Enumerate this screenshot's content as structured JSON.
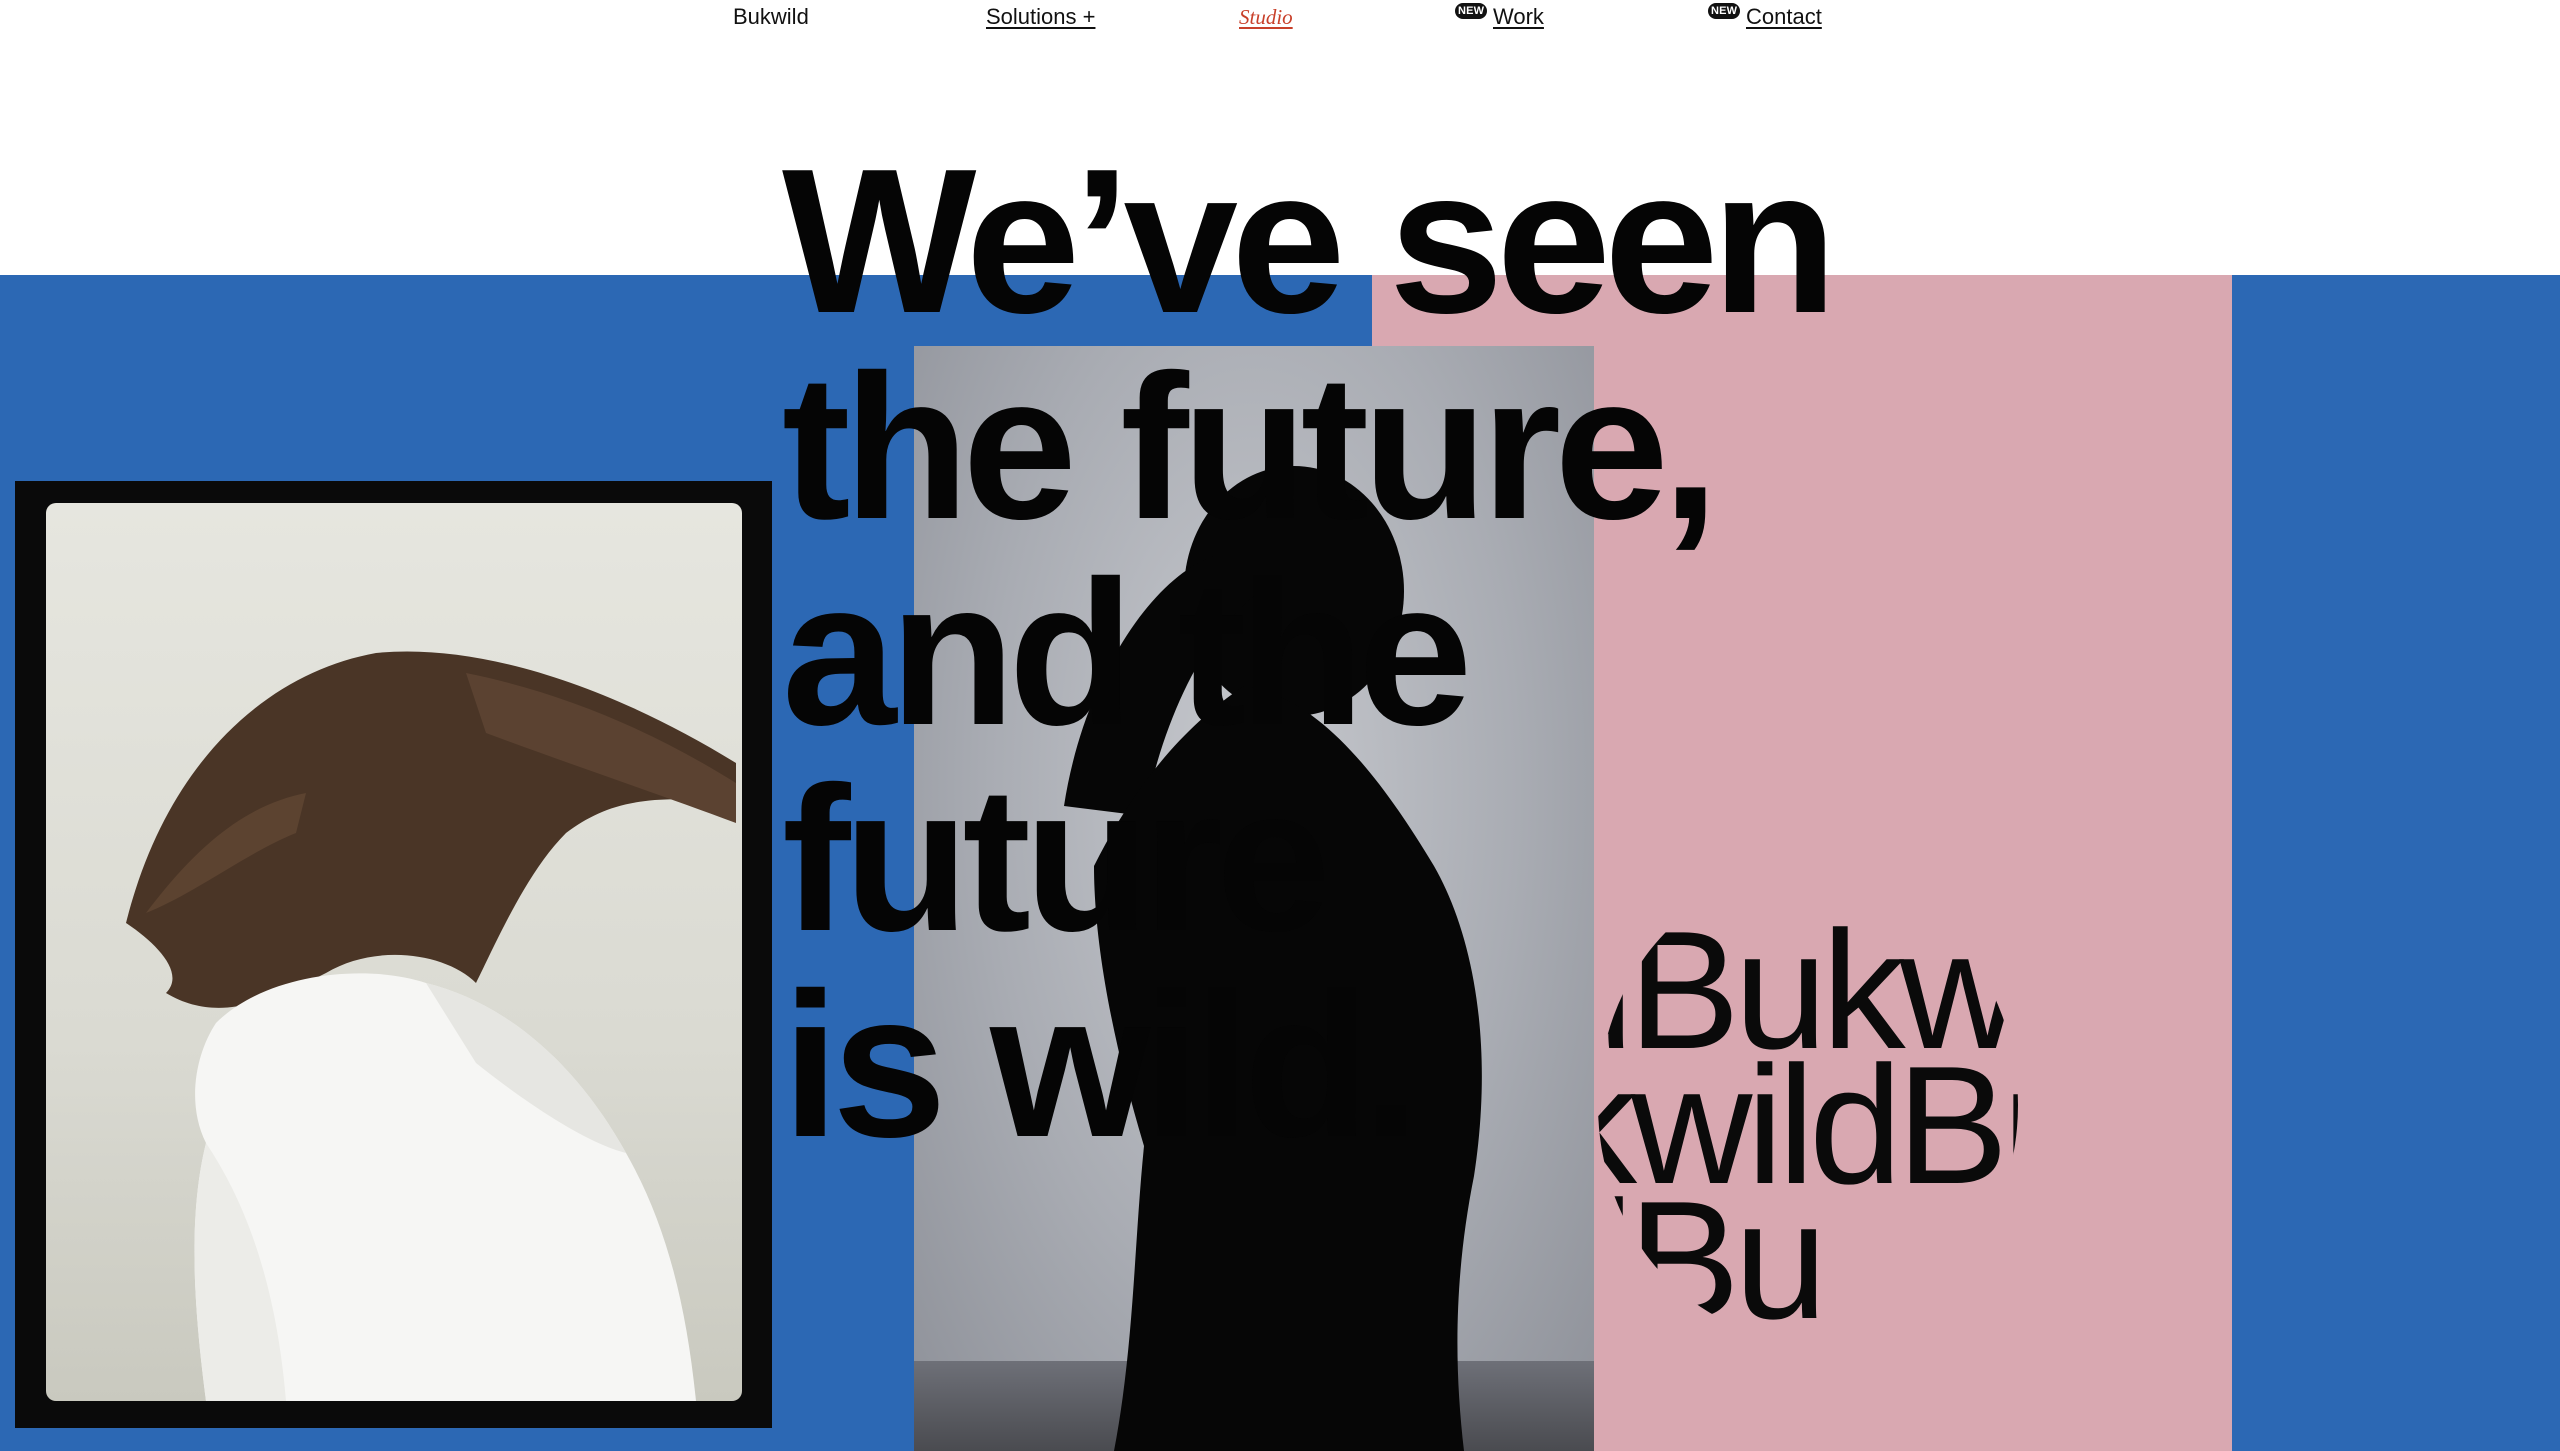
{
  "nav": {
    "logo": "Bukwild",
    "solutions": "Solutions +",
    "studio": "Studio",
    "work_badge": "NEW",
    "work": "Work",
    "contact_badge": "NEW",
    "contact": "Contact"
  },
  "hero": {
    "headline_lines": [
      "We’ve seen",
      "the future,",
      "and the",
      "future",
      "is wild."
    ],
    "wordmark_rows": [
      "ildBukwildBu",
      "kwildBu",
      "ildBu"
    ]
  },
  "colors": {
    "blue": "#2c68b4",
    "pink": "#d9a8b1",
    "studio_accent": "#c8402a",
    "text": "#050505"
  }
}
